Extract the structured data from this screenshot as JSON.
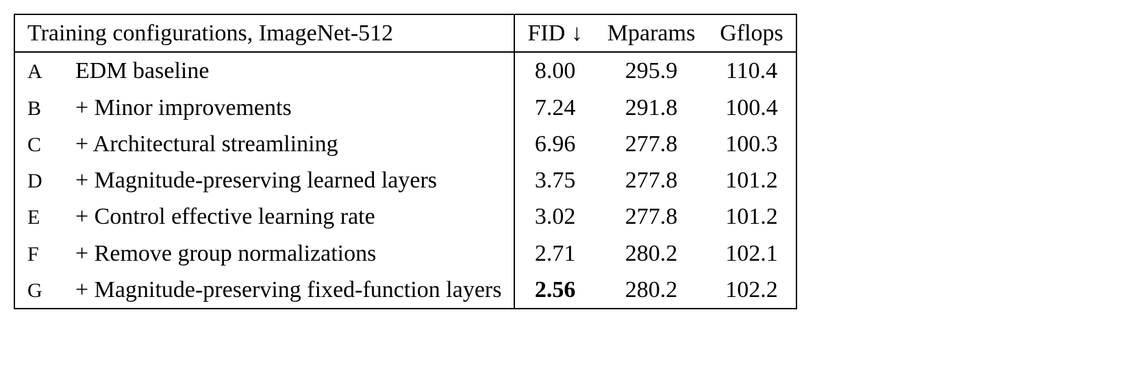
{
  "chart_data": {
    "type": "table",
    "title": "Training configurations, ImageNet-512",
    "columns": [
      "FID ↓",
      "Mparams",
      "Gflops"
    ],
    "rows": [
      {
        "id": "A",
        "name": "EDM baseline",
        "fid": "8.00",
        "mparams": "295.9",
        "gflops": "110.4",
        "bold": false
      },
      {
        "id": "B",
        "name": "+ Minor improvements",
        "fid": "7.24",
        "mparams": "291.8",
        "gflops": "100.4",
        "bold": false
      },
      {
        "id": "C",
        "name": "+ Architectural streamlining",
        "fid": "6.96",
        "mparams": "277.8",
        "gflops": "100.3",
        "bold": false
      },
      {
        "id": "D",
        "name": "+ Magnitude-preserving learned layers",
        "fid": "3.75",
        "mparams": "277.8",
        "gflops": "101.2",
        "bold": false
      },
      {
        "id": "E",
        "name": "+ Control effective learning rate",
        "fid": "3.02",
        "mparams": "277.8",
        "gflops": "101.2",
        "bold": false
      },
      {
        "id": "F",
        "name": "+ Remove group normalizations",
        "fid": "2.71",
        "mparams": "280.2",
        "gflops": "102.1",
        "bold": false
      },
      {
        "id": "G",
        "name": "+ Magnitude-preserving fixed-function layers",
        "fid": "2.56",
        "mparams": "280.2",
        "gflops": "102.2",
        "bold": true
      }
    ]
  }
}
